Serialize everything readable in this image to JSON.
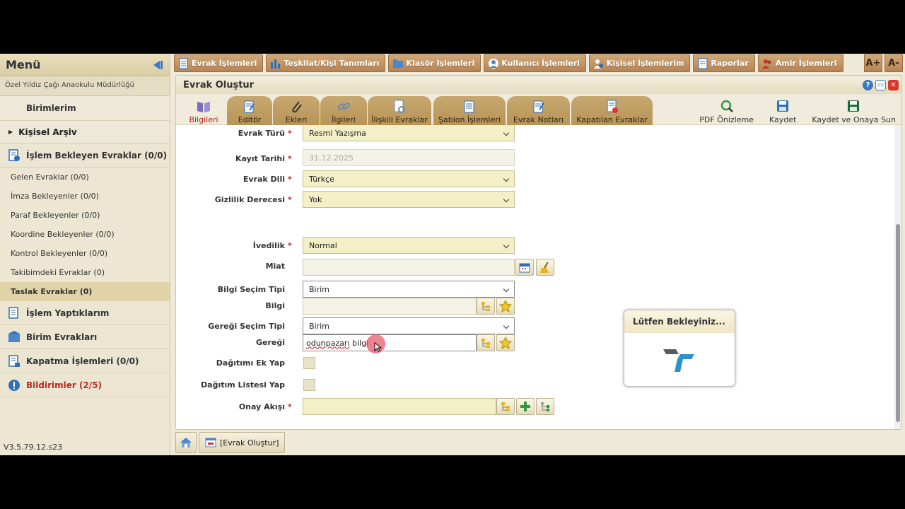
{
  "sidebar": {
    "title": "Menü",
    "org_name": "Özel Yıldız Çağı Anaokulu Müdürlüğü",
    "top_item": "Birimlerim",
    "archive": "Kişisel Arşiv",
    "pending_section": "İşlem Bekleyen Evraklar (0/0)",
    "items": [
      "Gelen Evraklar (0/0)",
      "İmza Bekleyenler (0/0)",
      "Paraf Bekleyenler (0/0)",
      "Koordine Bekleyenler (0/0)",
      "Kontrol Bekleyenler (0/0)",
      "Takibimdeki Evraklar (0)",
      "Taslak Evraklar (0)"
    ],
    "sections": [
      "İşlem Yaptıklarım",
      "Birim Evrakları",
      "Kapatma İşlemleri (0/0)",
      "Bildirimler (2/5)"
    ],
    "version": "V3.5.79.12.s23"
  },
  "topbar": {
    "items": [
      "Evrak İşlemleri",
      "Teşkilat/Kişi Tanımları",
      "Klasör İşlemleri",
      "Kullanıcı İşlemleri",
      "Kişisel İşlemlerim",
      "Raporlar",
      "Amir İşlemleri"
    ],
    "font_increase": "A+",
    "font_decrease": "A-"
  },
  "panel": {
    "title": "Evrak Oluştur",
    "tabs": [
      "Bilgileri",
      "Editör",
      "Ekleri",
      "İlgileri",
      "İlişkili Evraklar",
      "Şablon İşlemleri",
      "Evrak Notları",
      "Kapatılan Evraklar"
    ],
    "actions": [
      "PDF Önizleme",
      "Kaydet",
      "Kaydet ve Onaya Sun"
    ]
  },
  "form": {
    "evrak_turu": {
      "label": "Evrak Türü",
      "value": "Resmi Yazışma"
    },
    "kayit_tarihi": {
      "label": "Kayıt Tarihi",
      "value": "31.12.2025"
    },
    "evrak_dili": {
      "label": "Evrak Dili",
      "value": "Türkçe"
    },
    "gizlilik": {
      "label": "Gizlilik Derecesi",
      "value": "Yok"
    },
    "ivedilik": {
      "label": "İvedilik",
      "value": "Normal"
    },
    "miat": {
      "label": "Miat",
      "value": ""
    },
    "bilgi_secim_tipi": {
      "label": "Bilgi Seçim Tipi",
      "value": "Birim"
    },
    "bilgi": {
      "label": "Bilgi",
      "value": ""
    },
    "geregi_secim_tipi": {
      "label": "Gereği Seçim Tipi",
      "value": "Birim"
    },
    "geregi": {
      "label": "Gereği",
      "value_underlined": "odunpazarı",
      "value_rest": " bilgi"
    },
    "dagitimi_ek_yap": {
      "label": "Dağıtımı Ek Yap"
    },
    "dagitim_listesi_yap": {
      "label": "Dağıtım Listesi Yap"
    },
    "onay_akisi": {
      "label": "Onay Akışı",
      "value": ""
    },
    "required_mark": "*"
  },
  "loading": {
    "title": "Lütfen Bekleyiniz..."
  },
  "footer": {
    "tab_label": "[Evrak Oluştur]"
  },
  "colors": {
    "accent_brown": "#b68354",
    "field_yellow": "#f3efc6",
    "alert_red": "#c0271f",
    "blue": "#3a78c6"
  }
}
